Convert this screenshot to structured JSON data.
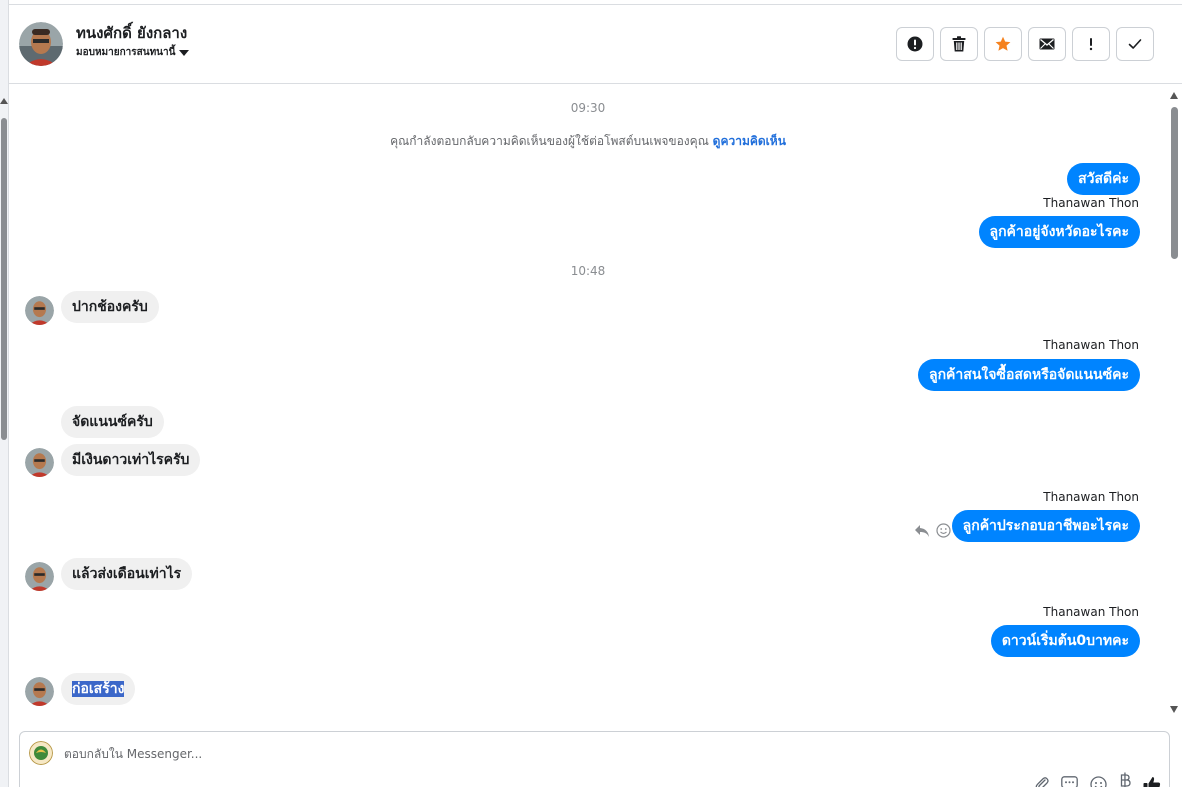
{
  "header": {
    "contact_name": "ทนงศักดิ์ ยังกลาง",
    "assign_label": "มอบหมายการสนทนานี้"
  },
  "actions": [
    {
      "name": "spam-button",
      "icon": "alert-circle-icon"
    },
    {
      "name": "delete-button",
      "icon": "trash-icon"
    },
    {
      "name": "star-button",
      "icon": "star-icon",
      "color": "#f5821f"
    },
    {
      "name": "mark-unread-button",
      "icon": "envelope-icon"
    },
    {
      "name": "follow-up-button",
      "icon": "exclamation-icon"
    },
    {
      "name": "mark-done-button",
      "icon": "check-icon"
    }
  ],
  "chat": {
    "timestamps": [
      "09:30",
      "10:48"
    ],
    "notice_text": "คุณกำลังตอบกลับความคิดเห็นของผู้ใช้ต่อโพสต์บนเพจของคุณ",
    "notice_link": "ดูความคิดเห็น",
    "messages": [
      {
        "direction": "out",
        "sender": "",
        "text": "สวัสดีค่ะ"
      },
      {
        "direction": "out",
        "sender": "Thanawan Thon",
        "text": "ลูกค้าอยู่จังหวัดอะไรคะ"
      },
      {
        "direction": "in",
        "sender": "",
        "text": "ปากช้องครับ"
      },
      {
        "direction": "out",
        "sender": "Thanawan Thon",
        "text": "ลูกค้าสนใจซื้อสดหรือจัดแนนซ์คะ"
      },
      {
        "direction": "in",
        "sender": "",
        "text": "จัดแนนซ์ครับ"
      },
      {
        "direction": "in",
        "sender": "",
        "text": "มีเงินดาวเท่าไรครับ"
      },
      {
        "direction": "out",
        "sender": "Thanawan Thon",
        "text": "ลูกค้าประกอบอาชีพอะไรคะ"
      },
      {
        "direction": "in",
        "sender": "",
        "text": "แล้วส่งเดือนเท่าไร"
      },
      {
        "direction": "out",
        "sender": "Thanawan Thon",
        "text": "ดาวน์เริ่มต้น0บาทคะ"
      },
      {
        "direction": "in",
        "sender": "",
        "text": "ก่อเสร้าง"
      }
    ]
  },
  "composer": {
    "placeholder": "ตอบกลับใน Messenger..."
  },
  "colors": {
    "outgoing_bubble": "#0084ff",
    "incoming_bubble": "#f0f0f0",
    "link": "#216fdb",
    "star": "#f5821f",
    "selection": "#3b67c9"
  }
}
